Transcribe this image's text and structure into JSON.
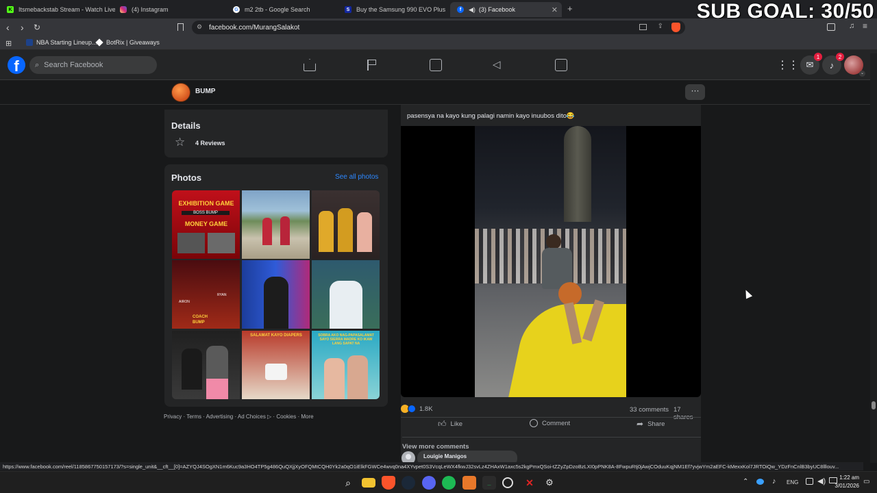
{
  "browser": {
    "tabs": [
      {
        "title": "Itsmebackstab Stream - Watch Live o",
        "icon": "kick-icon",
        "color": "#53fc18",
        "glyph": "K"
      },
      {
        "title": "(4) Instagram",
        "icon": "instagram-icon",
        "color": "#d62976",
        "glyph": ""
      },
      {
        "title": "m2 2tb - Google Search",
        "icon": "google-icon",
        "color": "#ffffff",
        "glyph": "G"
      },
      {
        "title": "Buy the Samsung 990 EVO Plus 2TB",
        "icon": "samsung-icon",
        "color": "#1428a0",
        "glyph": "S"
      },
      {
        "title": "(3) Facebook",
        "icon": "facebook-icon",
        "color": "#0866ff",
        "glyph": "f"
      }
    ],
    "overlay_text": "SUB GOAL: 30/50",
    "url": "facebook.com/MurangSalakot",
    "bookmarks": [
      {
        "label": "NBA Starting Lineup..."
      },
      {
        "label": "BotRix | Giveaways"
      }
    ],
    "status_url": "https://www.facebook.com/reel/1185867750157173/?s=single_unit&__cft__[0]=AZYQJ4SOgXN1m6Kuc9a3HO4TP5g486QuQXjjXyOFQMtCQH0Yk2a0qO1iElkFGWCe4wvq0na4XYvpet0S3VcqLeWX4fkwJ32svLz4ZHAxW1axc5s2kgPmxQSoi-tZZyZpDzoBzLXI0pPNK8A-8FwpuRtj0jAwjCOduuKqjNM1Ef7yvjwYm2aEFC-kMexxKol7JRTOiQw_YDzFnCnlB3byUC8lllouv..."
  },
  "facebook": {
    "search_placeholder": "Search Facebook",
    "notification_counts": {
      "messenger": "1",
      "notifications": "2"
    },
    "page_name": "BUMP",
    "details": {
      "heading": "Details",
      "reviews": "4 Reviews"
    },
    "photos": {
      "heading": "Photos",
      "see_all": "See all photos"
    },
    "footer_links": [
      "Privacy",
      "Terms",
      "Advertising",
      "Ad Choices ▷",
      "Cookies",
      "More"
    ],
    "post": {
      "caption": "pasensya na kayo kung palagi namin kayo inuubos dito😂",
      "reactions_count": "1.8K",
      "comments_count": "33 comments",
      "shares_count": "17 shares",
      "actions": {
        "like": "Like",
        "comment": "Comment",
        "share": "Share"
      },
      "view_more_comments": "View more comments",
      "commenter": "Louigie Manigos"
    }
  },
  "photo_texts": {
    "p1": [
      "EXHIBITION GAME",
      "BOSS BUMP",
      "MONEY GAME"
    ],
    "p4": [
      "AIRON",
      "RYAN",
      "COACH",
      "BUMP"
    ],
    "p8": "SALAMAT KAYO DIAPERS",
    "p9": "SOBRA AKO NAG-PAPASALAMAT SAYO SIERRA MADRE KO IKAW LANG SAPAT NA"
  },
  "taskbar": {
    "language": "ENG",
    "time": "1:22 am",
    "date": "3/01/2026"
  }
}
